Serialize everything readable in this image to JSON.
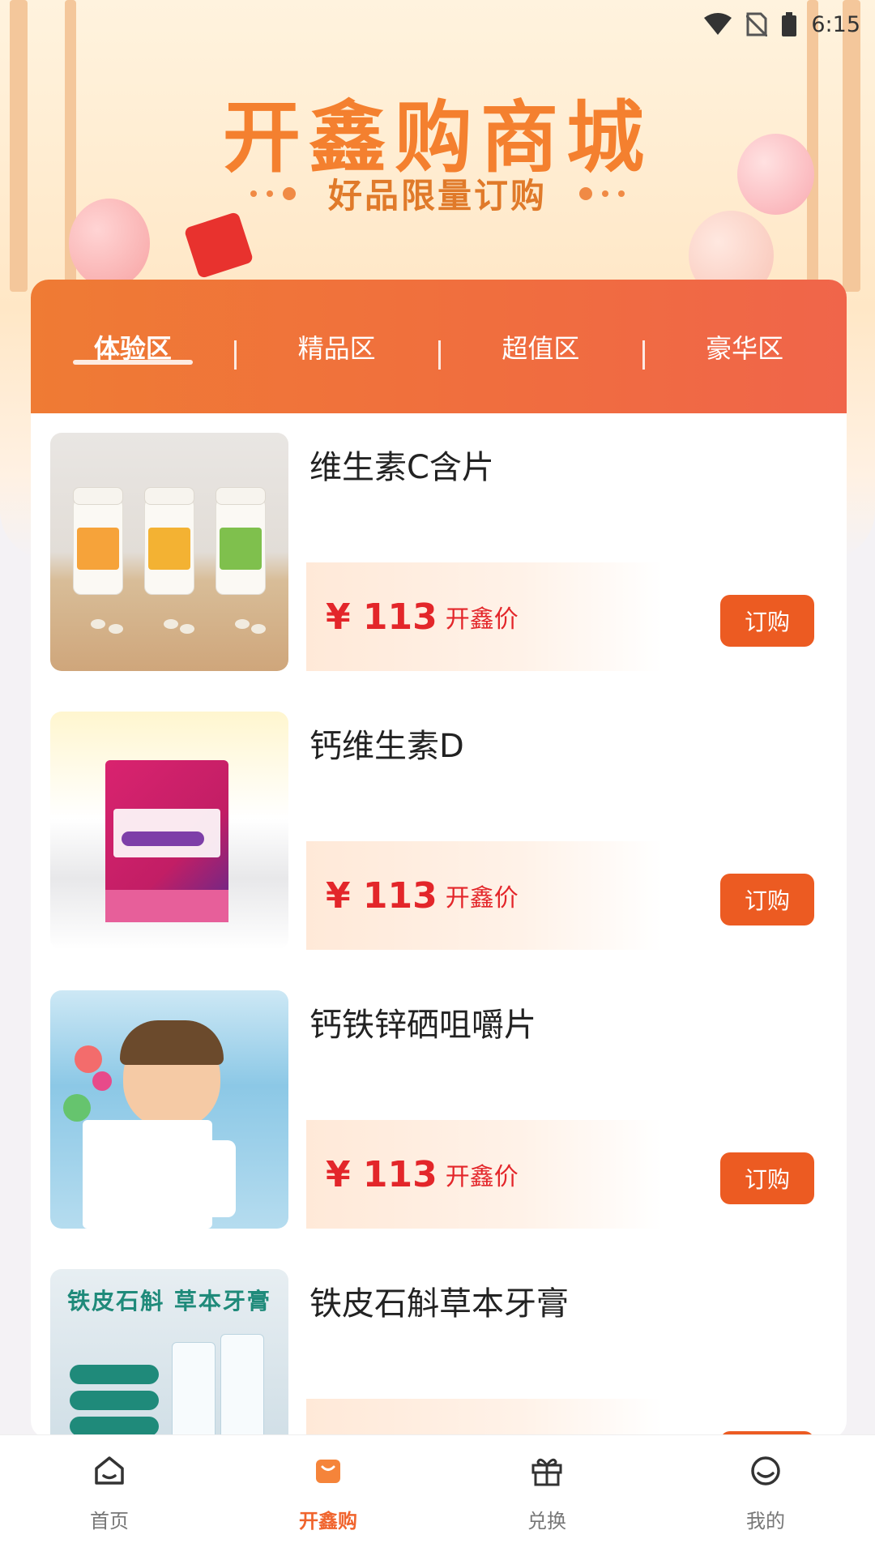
{
  "status_bar": {
    "time": "6:15"
  },
  "banner": {
    "title": "开鑫购商城",
    "subtitle": "好品限量订购"
  },
  "tabs": [
    {
      "label": "体验区",
      "active": true
    },
    {
      "label": "精品区",
      "active": false
    },
    {
      "label": "超值区",
      "active": false
    },
    {
      "label": "豪华区",
      "active": false
    }
  ],
  "products": [
    {
      "name": "维生素C含片",
      "price": "¥ 113",
      "price_label": "开鑫价",
      "button": "订购"
    },
    {
      "name": "钙维生素D",
      "price": "¥ 113",
      "price_label": "开鑫价",
      "button": "订购"
    },
    {
      "name": "钙铁锌硒咀嚼片",
      "price": "¥ 113",
      "price_label": "开鑫价",
      "button": "订购"
    },
    {
      "name": "铁皮石斛草本牙膏",
      "price": "",
      "price_label": "",
      "button": "",
      "image_heading": "铁皮石斛 草本牙膏"
    }
  ],
  "bottom_nav": [
    {
      "label": "首页",
      "icon": "home-icon",
      "active": false
    },
    {
      "label": "开鑫购",
      "icon": "shopping-bag-icon",
      "active": true
    },
    {
      "label": "兑换",
      "icon": "gift-icon",
      "active": false
    },
    {
      "label": "我的",
      "icon": "profile-icon",
      "active": false
    }
  ],
  "colors": {
    "accent": "#f0642d",
    "price": "#e3262a",
    "button": "#ec5b22"
  }
}
